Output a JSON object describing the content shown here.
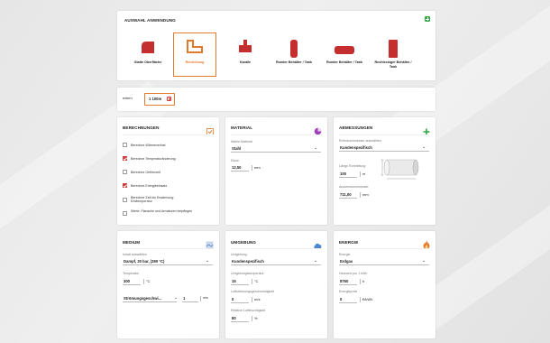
{
  "selection": {
    "title": "AUSWAHL ANWENDUNG",
    "items": [
      {
        "label": "Glatte Oberfläche"
      },
      {
        "label": "Rohrleitung",
        "active": true
      },
      {
        "label": "Kanäle"
      },
      {
        "label": "Runder Behälter / Tank"
      },
      {
        "label": "Runder Behälter / Tank"
      },
      {
        "label": "Rechteckiger Behälter / Tank"
      }
    ]
  },
  "size": {
    "label": "extern",
    "value": "1 100m",
    "accent": "#e27a2e"
  },
  "calc": {
    "title": "BERECHNUNGEN",
    "options": [
      {
        "label": "Berechne Wärmeverlust",
        "checked": false
      },
      {
        "label": "Berechne Temperaturänderung",
        "checked": true
      },
      {
        "label": "Berechne Gefrierzeit",
        "checked": false
      },
      {
        "label": "Berechne Energieeinsatz",
        "checked": true
      },
      {
        "label": "Berechne Zeit bis Erwärmung Endtemperatur",
        "checked": false
      },
      {
        "label": "Werte: Flansche und Armaturen beipflegen",
        "checked": false
      }
    ]
  },
  "material": {
    "title": "MATERIAL",
    "material_label": "Wahle Material",
    "material_value": "Stahl",
    "dicke_label": "Dicke",
    "dicke_value": "12,50",
    "dicke_unit": "mm"
  },
  "dimensions": {
    "title": "ABMESSUNGEN",
    "type_label": "Rohrdurchmesser auswählen",
    "type_value": "Kundenspezifisch",
    "length_label": "Länge Rohrleitung",
    "length_value": "100",
    "length_unit": "m",
    "outer_label": "Aussendurchmesser",
    "outer_value": "711,00",
    "outer_unit": "mm"
  },
  "medium": {
    "title": "MEDIUM",
    "medium_label": "Inhalt auswählen",
    "medium_value": "Dampf, 20 bar, (390 °C)",
    "temp_label": "Temperatur",
    "temp_value": "300",
    "temp_unit": "°C",
    "flow_value": "Strömungsgeschwi...",
    "flow_num": "1",
    "flow_unit": "m/s"
  },
  "environment": {
    "title": "UMGEBUNG",
    "env_label": "Umgebung",
    "env_value": "Kundenspezifisch",
    "ambient_label": "Umgebungstemperatur",
    "ambient_value": "15",
    "ambient_unit": "°C",
    "air_label": "Luftströmungsgeschwindigkeit",
    "air_value": "0",
    "air_unit": "m/s",
    "humidity_label": "Relative Luftfeuchtigkeit",
    "humidity_value": "80",
    "humidity_unit": "%"
  },
  "energy": {
    "title": "ENERGIE",
    "energy_label": "Energie",
    "energy_value": "Erdgas",
    "heat_label": "Heizwert pro 1 kWh",
    "heat_value": "8760",
    "heat_unit": "h",
    "price_label": "Energiepreis",
    "price_value": "0",
    "price_unit": "€/kWh"
  },
  "icon_colors": {
    "red": "#c42e2e",
    "orange": "#e27a2e",
    "green": "#39a94a",
    "blue": "#4c86cf",
    "purple": "#a13fb9"
  }
}
